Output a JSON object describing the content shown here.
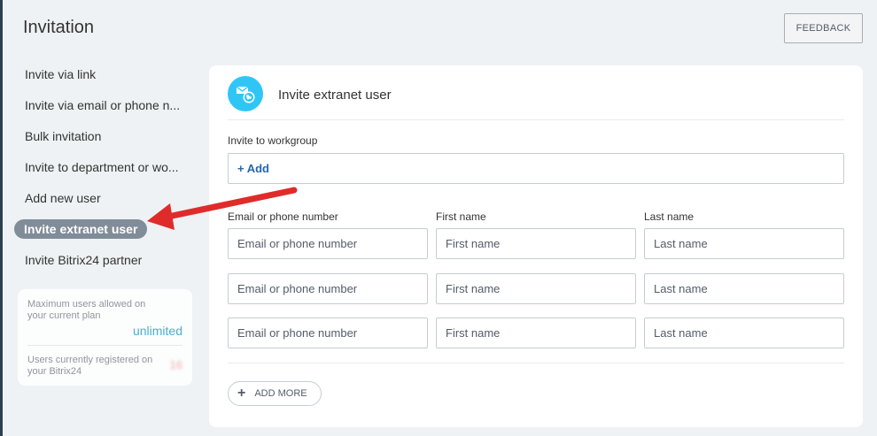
{
  "header": {
    "title": "Invitation",
    "feedback_label": "FEEDBACK"
  },
  "menu": {
    "items": [
      {
        "label": "Invite via link"
      },
      {
        "label": "Invite via email or phone n..."
      },
      {
        "label": "Bulk invitation"
      },
      {
        "label": "Invite to department or wo..."
      },
      {
        "label": "Add new user"
      },
      {
        "label": "Invite extranet user"
      },
      {
        "label": "Invite Bitrix24 partner"
      }
    ],
    "active_item": "Invite extranet user"
  },
  "limits": {
    "max_label": "Maximum users allowed on your current plan",
    "max_value": "unlimited",
    "registered_label": "Users currently registered on your Bitrix24",
    "registered_value": "16"
  },
  "panel": {
    "title": "Invite extranet user",
    "workgroup_label": "Invite to workgroup",
    "workgroup_add": "+ Add",
    "columns": {
      "email": "Email or phone number",
      "first": "First name",
      "last": "Last name"
    },
    "placeholders": {
      "email": "Email or phone number",
      "first": "First name",
      "last": "Last name"
    },
    "add_more_label": "ADD MORE"
  },
  "colors": {
    "accent": "#2fc6f6",
    "link": "#2067b0",
    "active_pill": "#818c99",
    "arrow": "#e02b2b"
  }
}
